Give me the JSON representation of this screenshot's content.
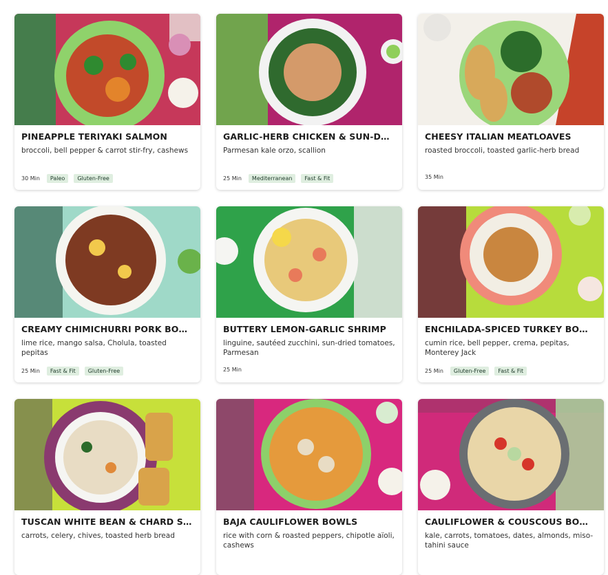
{
  "recipes": [
    {
      "title": "PINEAPPLE TERIYAKI SALMON",
      "subtitle": "broccoli, bell pepper & carrot stir-fry, cashews",
      "time": "30 Min",
      "tags": [
        "Paleo",
        "Gluten-Free"
      ],
      "bg": "#c6385a",
      "plate": "#8fd26b",
      "food": "#e3842b"
    },
    {
      "title": "GARLIC-HERB CHICKEN & SUN-DRIED ...",
      "subtitle": "Parmesan kale orzo, scallion",
      "time": "25 Min",
      "tags": [
        "Mediterranean",
        "Fast & Fit"
      ],
      "bg": "#b0246c",
      "plate": "#f2f2f2",
      "food": "#d49a6a"
    },
    {
      "title": "CHEESY ITALIAN MEATLOAVES",
      "subtitle": "roasted broccoli, toasted garlic-herb bread",
      "time": "35 Min",
      "tags": [],
      "bg": "#f3f0ea",
      "plate": "#9bd67a",
      "food": "#b04a2c"
    },
    {
      "title": "CREAMY CHIMICHURRI PORK BOWLS",
      "subtitle": "lime rice, mango salsa, Cholula, toasted pepitas",
      "time": "25 Min",
      "tags": [
        "Fast & Fit",
        "Gluten-Free"
      ],
      "bg": "#9fd9c8",
      "plate": "#f5f5f0",
      "food": "#8e3e25"
    },
    {
      "title": "BUTTERY LEMON-GARLIC SHRIMP",
      "subtitle": "linguine, sautéed zucchini, sun-dried tomatoes, Parmesan",
      "time": "25 Min",
      "tags": [],
      "bg": "#2fa24a",
      "plate": "#f5f5f2",
      "food": "#e8c97a"
    },
    {
      "title": "ENCHILADA-SPICED TURKEY BOWLS",
      "subtitle": "cumin rice, bell pepper, crema, pepitas, Monterey Jack",
      "time": "25 Min",
      "tags": [
        "Gluten-Free",
        "Fast & Fit"
      ],
      "bg": "#b7dc3c",
      "plate": "#f08a7a",
      "food": "#c9863f"
    },
    {
      "title": "TUSCAN WHITE BEAN & CHARD SOUP",
      "subtitle": "carrots, celery, chives, toasted herb bread",
      "time": "",
      "tags": [],
      "bg": "#c7e03a",
      "plate": "#8a3a6f",
      "food": "#e8dcc4"
    },
    {
      "title": "BAJA CAULIFLOWER BOWLS",
      "subtitle": "rice with corn & roasted peppers, chipotle aïoli, cashews",
      "time": "",
      "tags": [],
      "bg": "#d8287e",
      "plate": "#8dd06a",
      "food": "#e59a3c"
    },
    {
      "title": "CAULIFLOWER & COUSCOUS BOWLS",
      "subtitle": "kale, carrots, tomatoes, dates, almonds, miso-tahini sauce",
      "time": "",
      "tags": [],
      "bg": "#d02a7a",
      "plate": "#6a6e72",
      "food": "#e9d6a8"
    }
  ]
}
